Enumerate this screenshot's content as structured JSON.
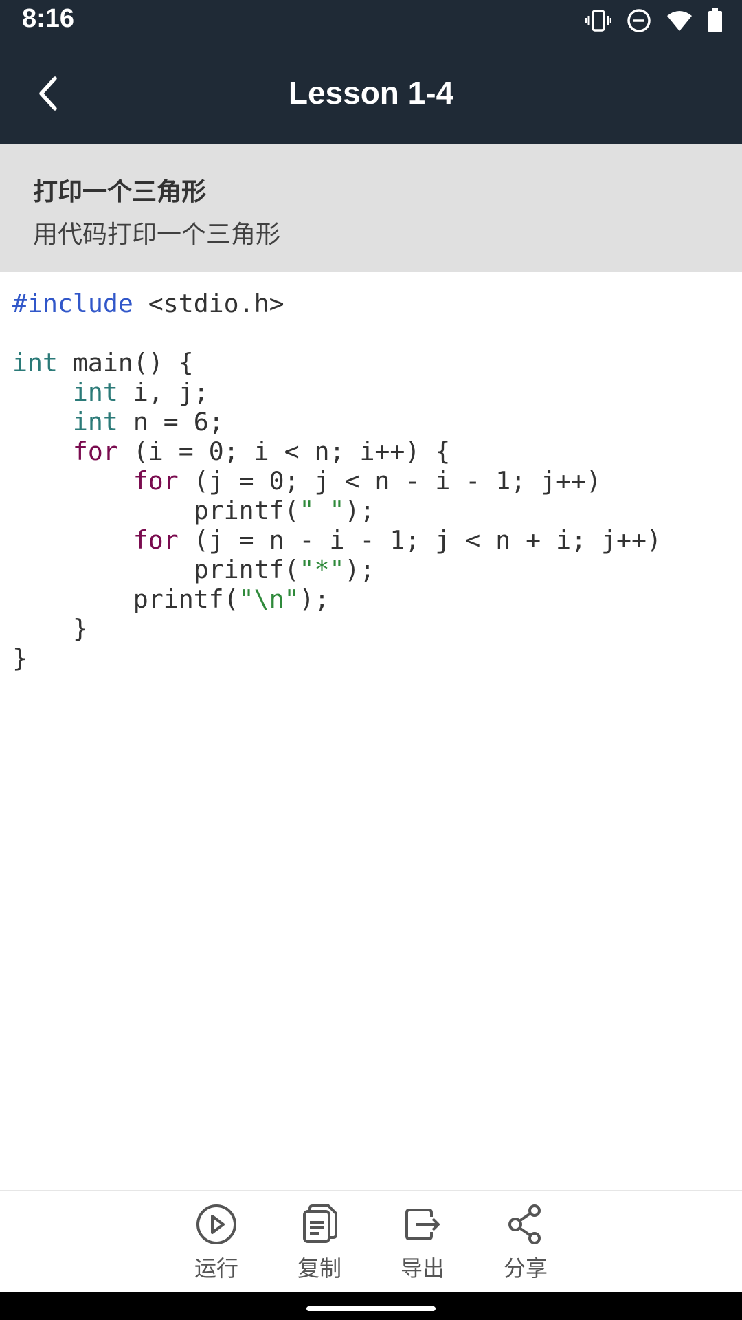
{
  "status_bar": {
    "time": "8:16",
    "icons": [
      "vibrate-icon",
      "do-not-disturb-icon",
      "wifi-icon",
      "battery-icon"
    ]
  },
  "app_bar": {
    "back_icon": "chevron-left-icon",
    "title": "Lesson 1-4",
    "background": "#1f2a36"
  },
  "lesson": {
    "title": "打印一个三角形",
    "description": "用代码打印一个三角形"
  },
  "code": {
    "language": "C",
    "lines": [
      "#include <stdio.h>",
      "",
      "int main() {",
      "    int i, j;",
      "    int n = 6;",
      "    for (i = 0; i < n; i++) {",
      "        for (j = 0; j < n - i - 1; j++)",
      "            printf(\" \");",
      "        for (j = n - i - 1; j < n + i; j++)",
      "            printf(\"*\");",
      "        printf(\"\\n\");",
      "    }",
      "}"
    ],
    "colors": {
      "preprocessor": "#3157c9",
      "type": "#2b7a78",
      "keyword": "#7a0c4f",
      "string": "#2f8a3b",
      "text": "#333333"
    }
  },
  "toolbar": {
    "items": [
      {
        "icon": "play-circle-icon",
        "label": "运行"
      },
      {
        "icon": "copy-icon",
        "label": "复制"
      },
      {
        "icon": "export-icon",
        "label": "导出"
      },
      {
        "icon": "share-icon",
        "label": "分享"
      }
    ]
  }
}
